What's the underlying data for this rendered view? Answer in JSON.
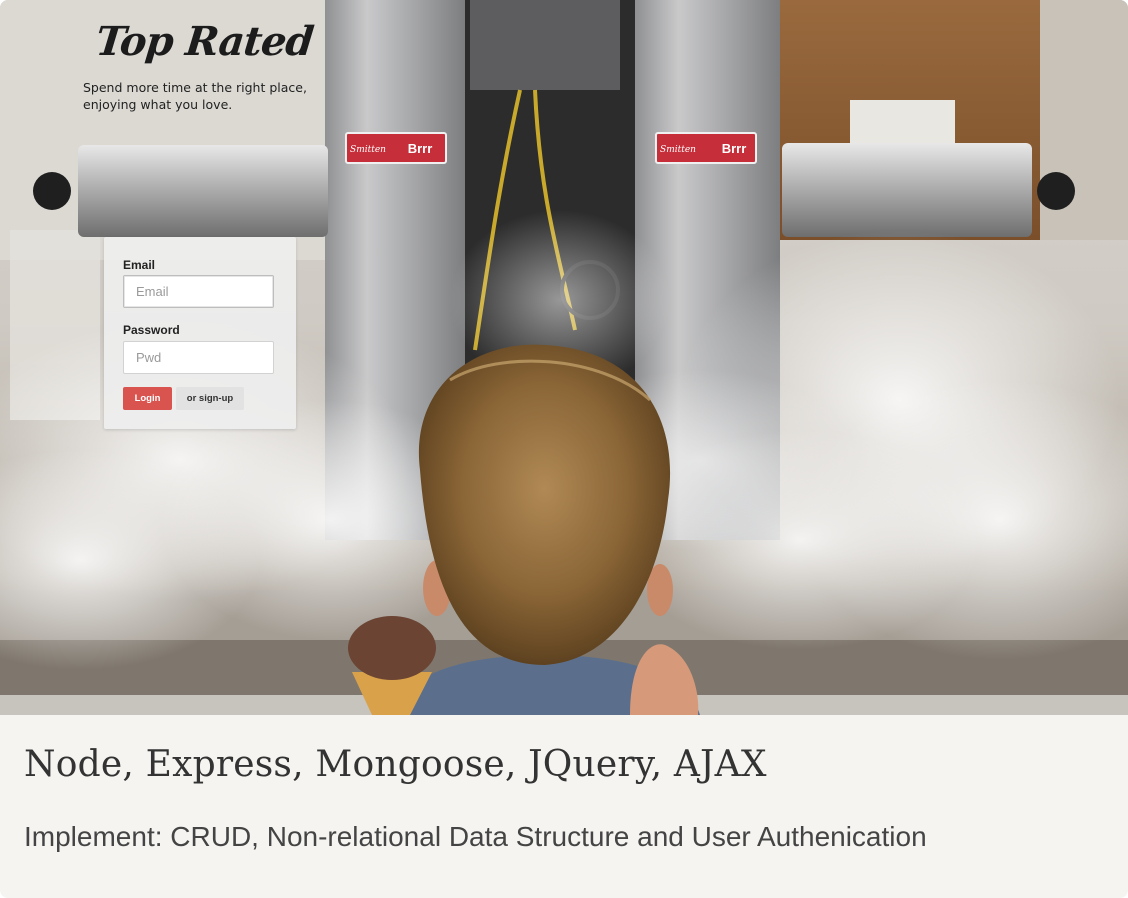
{
  "hero": {
    "brand": "Top Rated",
    "tagline": "Spend more time at the right place, enjoying what you love.",
    "badge_text": "Brrr"
  },
  "login": {
    "email_label": "Email",
    "email_placeholder": "Email",
    "password_label": "Password",
    "password_placeholder": "Pwd",
    "login_button": "Login",
    "signup_button": "or sign-up",
    "accent_color": "#d9534f"
  },
  "caption": {
    "title": "Node, Express, Mongoose, JQuery, AJAX",
    "subtitle": "Implement: CRUD, Non-relational Data Structure and User Authenication"
  }
}
